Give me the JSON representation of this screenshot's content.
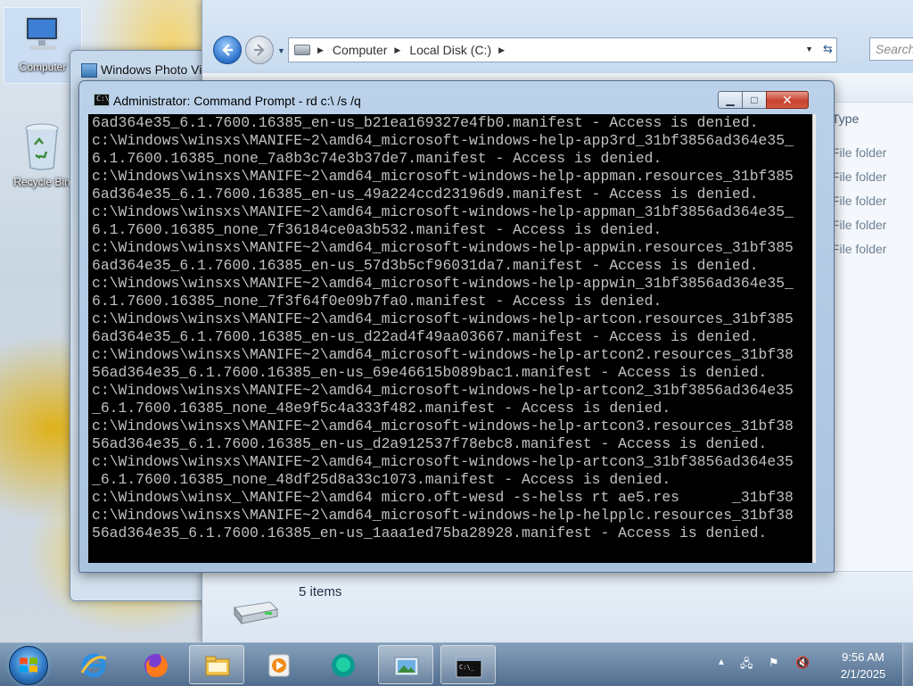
{
  "desktop": {
    "icons": [
      {
        "label": "Computer"
      },
      {
        "label": "Recycle Bin"
      }
    ]
  },
  "photo_viewer": {
    "title": "Windows Photo Viewer"
  },
  "explorer": {
    "address": {
      "seg1": "Computer",
      "seg2": "Local Disk (C:)"
    },
    "search_placeholder": "Search",
    "column_header": "Type",
    "item_types": [
      "File folder",
      "File folder",
      "File folder",
      "File folder",
      "File folder"
    ],
    "status": "5 items"
  },
  "cmd": {
    "title": "Administrator:  Command Prompt - rd  c:\\ /s /q",
    "lines": [
      "6ad364e35_6.1.7600.16385_en-us_b21ea169327e4fb0.manifest - Access is denied.",
      "c:\\Windows\\winsxs\\MANIFE~2\\amd64_microsoft-windows-help-app3rd_31bf3856ad364e35_",
      "6.1.7600.16385_none_7a8b3c74e3b37de7.manifest - Access is denied.",
      "c:\\Windows\\winsxs\\MANIFE~2\\amd64_microsoft-windows-help-appman.resources_31bf385",
      "6ad364e35_6.1.7600.16385_en-us_49a224ccd23196d9.manifest - Access is denied.",
      "c:\\Windows\\winsxs\\MANIFE~2\\amd64_microsoft-windows-help-appman_31bf3856ad364e35_",
      "6.1.7600.16385_none_7f36184ce0a3b532.manifest - Access is denied.",
      "c:\\Windows\\winsxs\\MANIFE~2\\amd64_microsoft-windows-help-appwin.resources_31bf385",
      "6ad364e35_6.1.7600.16385_en-us_57d3b5cf96031da7.manifest - Access is denied.",
      "c:\\Windows\\winsxs\\MANIFE~2\\amd64_microsoft-windows-help-appwin_31bf3856ad364e35_",
      "6.1.7600.16385_none_7f3f64f0e09b7fa0.manifest - Access is denied.",
      "c:\\Windows\\winsxs\\MANIFE~2\\amd64_microsoft-windows-help-artcon.resources_31bf385",
      "6ad364e35_6.1.7600.16385_en-us_d22ad4f49aa03667.manifest - Access is denied.",
      "c:\\Windows\\winsxs\\MANIFE~2\\amd64_microsoft-windows-help-artcon2.resources_31bf38",
      "56ad364e35_6.1.7600.16385_en-us_69e46615b089bac1.manifest - Access is denied.",
      "c:\\Windows\\winsxs\\MANIFE~2\\amd64_microsoft-windows-help-artcon2_31bf3856ad364e35",
      "_6.1.7600.16385_none_48e9f5c4a333f482.manifest - Access is denied.",
      "c:\\Windows\\winsxs\\MANIFE~2\\amd64_microsoft-windows-help-artcon3.resources_31bf38",
      "56ad364e35_6.1.7600.16385_en-us_d2a912537f78ebc8.manifest - Access is denied.",
      "c:\\Windows\\winsxs\\MANIFE~2\\amd64_microsoft-windows-help-artcon3_31bf3856ad364e35",
      "_6.1.7600.16385_none_48df25d8a33c1073.manifest - Access is denied.",
      "c:\\Windows\\winsx_\\MANIFE~2\\amd64 micro.oft-wesd -s-helss rt ae5.res      _31bf38",
      "c:\\Windows\\winsxs\\MANIFE~2\\amd64_microsoft-windows-help-helpplc.resources_31bf38",
      "56ad364e35_6.1.7600.16385_en-us_1aaa1ed75ba28928.manifest - Access is denied."
    ]
  },
  "taskbar": {
    "clock_time": "9:56 AM",
    "clock_date": "2/1/2025",
    "buttons": [
      "start-orb",
      "internet-explorer-icon",
      "firefox-icon",
      "file-explorer-icon",
      "media-player-icon",
      "green-app-icon",
      "photo-viewer-icon",
      "command-prompt-icon"
    ]
  }
}
